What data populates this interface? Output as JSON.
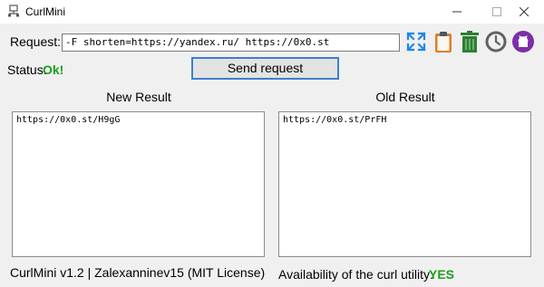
{
  "window": {
    "title": "CurlMini",
    "app_icon": "network-icon",
    "controls": [
      "minimize",
      "maximize",
      "close"
    ]
  },
  "request": {
    "label": "Request:",
    "value": "-F shorten=https://yandex.ru/ https://0x0.st"
  },
  "toolbar": {
    "icons": [
      "expand-icon",
      "clipboard-icon",
      "trash-icon",
      "clock-icon",
      "github-icon"
    ],
    "colors": {
      "accent_blue": "#1e88e5",
      "clipboard": "#e07c2a",
      "trash": "#2e7d32",
      "clock": "#616161",
      "github": "#7b2fa8"
    }
  },
  "status": {
    "label": "Status:",
    "value": "Ok!",
    "color": "#1aa01a"
  },
  "send_button": {
    "label": "Send request"
  },
  "results": {
    "new_title": "New Result",
    "new_value": "https://0x0.st/H9gG",
    "old_title": "Old Result",
    "old_value": "https://0x0.st/PrFH"
  },
  "footer": {
    "left": "CurlMini v1.2 |  Zalexanninev15 (MIT License)",
    "availability_label": "Availability of the curl utility:",
    "availability_value": "YES"
  }
}
